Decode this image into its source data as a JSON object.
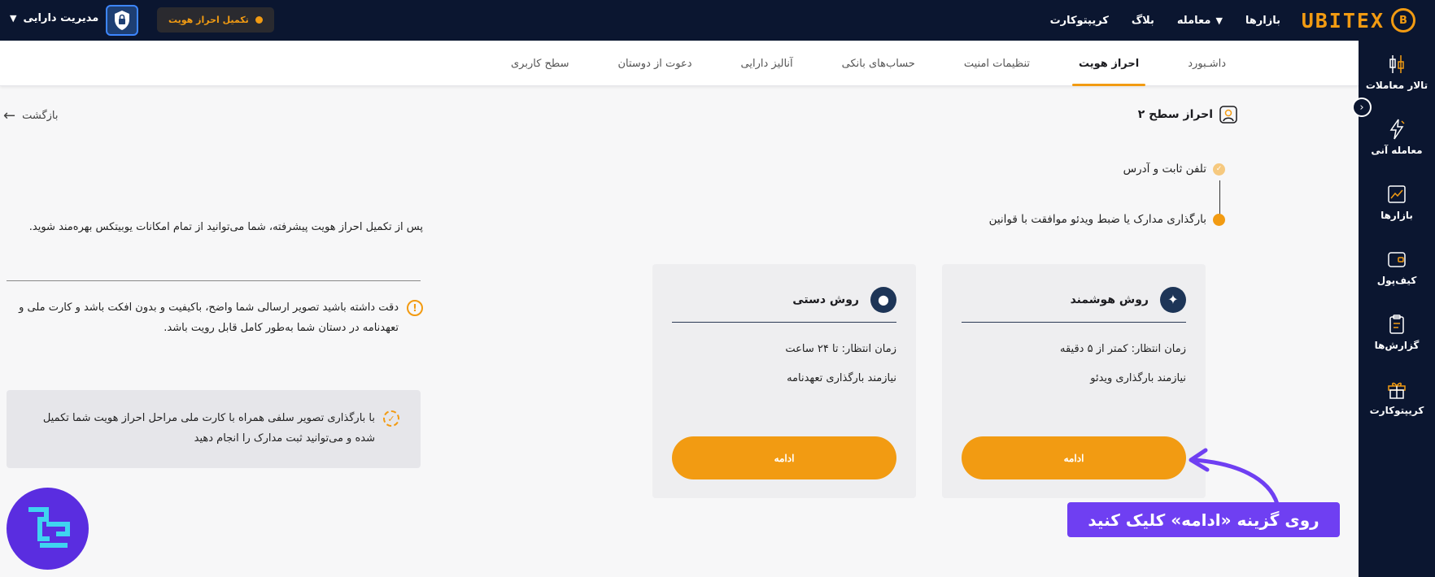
{
  "brand": {
    "name": "UBITEX",
    "logo_mark": "B"
  },
  "topbar": {
    "nav": [
      {
        "label": "بازارها",
        "has_chevron": false
      },
      {
        "label": "معامله",
        "has_chevron": true
      },
      {
        "label": "بلاگ",
        "has_chevron": false
      },
      {
        "label": "کریپتوکارت",
        "has_chevron": false
      }
    ],
    "asset_menu": "مدیریت دارایی",
    "shield_icon": "shield-lock-icon",
    "verify_pill": "تکمیل احراز هویت"
  },
  "sidebar": {
    "items": [
      {
        "label": "تالار معاملات",
        "icon": "candlestick-icon"
      },
      {
        "label": "معامله آنی",
        "icon": "lightning-icon"
      },
      {
        "label": "بازارها",
        "icon": "market-chart-icon"
      },
      {
        "label": "کیف‌پول",
        "icon": "wallet-icon"
      },
      {
        "label": "گزارش‌ها",
        "icon": "clipboard-icon"
      },
      {
        "label": "کریپتوکارت",
        "icon": "gift-icon"
      }
    ]
  },
  "tabs": {
    "items": [
      "داشـبورد",
      "احراز هویت",
      "تنظیمات امنیت",
      "حساب‌های بانکی",
      "آنالیز دارایی",
      "دعوت از دوستان",
      "سطح کاربری"
    ],
    "active_index": 1
  },
  "back_label": "بازگشت",
  "page_title": "احراز سطح ۲",
  "steps": [
    {
      "label": "تلفن ثابت و آدرس",
      "done": true
    },
    {
      "label": "بارگذاری مدارک یا ضبط ویدئو موافقت با قوانین",
      "done": false
    }
  ],
  "info_text": "پس از تکمیل احراز هویت پیشرفته، شما می‌توانید از تمام امکانات یوبیتکس بهره‌مند شوید.",
  "warning_text": "دقت داشته باشید تصویر ارسالی شما واضح، باکیفیت و بدون افکت باشد و کارت ملی و تعهدنامه در دستان شما به‌طور کامل قابل رویت باشد.",
  "note_text": "با بارگذاری تصویر سلفی همراه با کارت ملی مراحل احراز هویت شما تکمیل شده و می‌توانید ثبت مدارک را انجام دهید",
  "cards": [
    {
      "title": "روش هوشمند",
      "icon": "sparkle-icon",
      "wait": "زمان انتظار: کمتر از ۵ دقیقه",
      "requirement": "نیازمند بارگذاری ویدئو",
      "button": "ادامه"
    },
    {
      "title": "روش دستی",
      "icon": "dot-circle-icon",
      "wait": "زمان انتظار: تا ۲۴ ساعت",
      "requirement": "نیازمند بارگذاری تعهدنامه",
      "button": "ادامه"
    }
  ],
  "callout": "روی گزینه «ادامه» کلیک کنید",
  "colors": {
    "accent": "#f29b12",
    "navy": "#0b1630",
    "purple": "#6f3ff2"
  }
}
